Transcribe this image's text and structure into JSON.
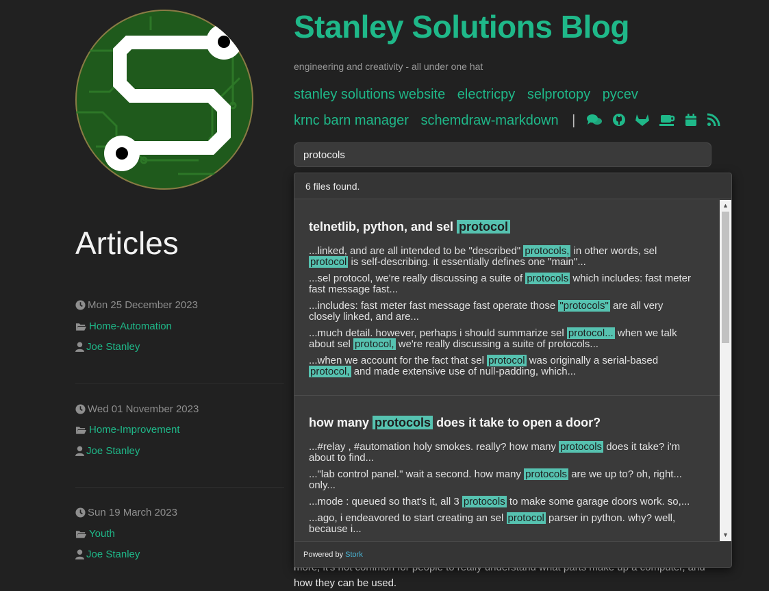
{
  "site": {
    "title": "Stanley Solutions Blog",
    "tagline": "engineering and creativity - all under one hat"
  },
  "nav": {
    "row1": [
      "stanley solutions website",
      "electricpy",
      "selprotopy",
      "pycev"
    ],
    "row2": [
      "krnc barn manager",
      "schemdraw-markdown"
    ],
    "separator": "|",
    "icons": [
      "chat-icon",
      "github-icon",
      "gitlab-icon",
      "coffee-icon",
      "calendar-icon",
      "rss-icon"
    ]
  },
  "search": {
    "value": "protocols"
  },
  "articles": {
    "heading": "Articles",
    "items": [
      {
        "date": "Mon 25 December 2023",
        "category": "Home-Automation",
        "author": "Joe Stanley"
      },
      {
        "date": "Wed 01 November 2023",
        "category": "Home-Improvement",
        "author": "Joe Stanley"
      },
      {
        "date": "Sun 19 March 2023",
        "category": "Youth",
        "author": "Joe Stanley"
      }
    ]
  },
  "background_text": {
    "line1": "more, it's not common for people to really understand what parts make up a computer, and",
    "line2": "how they can be used."
  },
  "results": {
    "count_text": "6 files found.",
    "powered_by": "Powered by",
    "powered_link": "Stork",
    "items": [
      {
        "title_pre": "telnetlib, python, and sel",
        "title_mark": "protocol",
        "title_post": "",
        "excerpts": [
          {
            "segments": [
              {
                "t": "...linked, and are all intended to be \"described\" "
              },
              {
                "t": "protocols,",
                "m": true
              },
              {
                "t": " in other words, sel"
              },
              {
                "br": true
              },
              {
                "t": "protocol",
                "m": true
              },
              {
                "t": " is self-describing. it essentially defines one \"main\"..."
              }
            ]
          },
          {
            "segments": [
              {
                "t": "...sel protocol, we're really discussing a suite of "
              },
              {
                "t": "protocols",
                "m": true
              },
              {
                "t": " which includes: fast meter"
              },
              {
                "br": true
              },
              {
                "t": "fast message fast..."
              }
            ]
          },
          {
            "segments": [
              {
                "t": "...includes: fast meter fast message fast operate those "
              },
              {
                "t": "\"protocols\"",
                "m": true
              },
              {
                "t": " are all very"
              },
              {
                "br": true
              },
              {
                "t": "closely linked, and are..."
              }
            ]
          },
          {
            "segments": [
              {
                "t": "...much detail. however, perhaps i should summarize sel "
              },
              {
                "t": "protocol...",
                "m": true
              },
              {
                "t": " when we talk"
              },
              {
                "br": true
              },
              {
                "t": "about sel "
              },
              {
                "t": "protocol,",
                "m": true
              },
              {
                "t": " we're really discussing a suite of protocols..."
              }
            ]
          },
          {
            "segments": [
              {
                "t": "...when we account for the fact that sel "
              },
              {
                "t": "protocol",
                "m": true
              },
              {
                "t": " was originally a serial-based"
              },
              {
                "br": true
              },
              {
                "t": "protocol,",
                "m": true
              },
              {
                "t": " and made extensive use of null-padding, which..."
              }
            ]
          }
        ]
      },
      {
        "title_pre": "how many",
        "title_mark": "protocols",
        "title_post": "does it take to open a door?",
        "excerpts": [
          {
            "segments": [
              {
                "t": "...#relay , #automation holy smokes. really? how many "
              },
              {
                "t": "protocols",
                "m": true
              },
              {
                "t": " does it take? i'm"
              },
              {
                "br": true
              },
              {
                "t": "about to find..."
              }
            ]
          },
          {
            "segments": [
              {
                "t": "...\"lab control panel.\" wait a second. how many "
              },
              {
                "t": "protocols",
                "m": true
              },
              {
                "t": " are we up to? oh, right..."
              },
              {
                "br": true
              },
              {
                "t": "only..."
              }
            ]
          },
          {
            "segments": [
              {
                "t": "...mode : queued so that's it, all 3 "
              },
              {
                "t": "protocols",
                "m": true
              },
              {
                "t": " to make some garage doors work. so,..."
              }
            ]
          },
          {
            "segments": [
              {
                "t": "...ago, i endeavored to start creating an sel "
              },
              {
                "t": "protocol",
                "m": true
              },
              {
                "t": " parser in python. why? well,"
              },
              {
                "br": true
              },
              {
                "t": "because i..."
              }
            ]
          }
        ]
      }
    ]
  },
  "colors": {
    "accent": "#1fb889",
    "highlight": "#56c2b0",
    "background": "#212121"
  }
}
